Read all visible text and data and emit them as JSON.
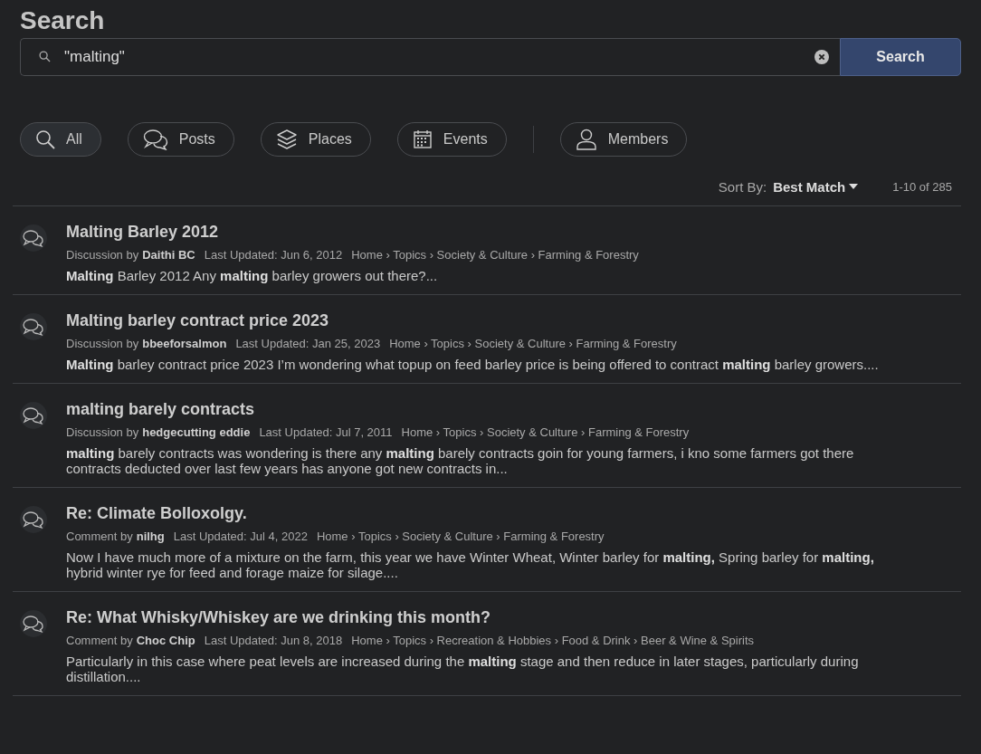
{
  "heading": "Search",
  "search": {
    "value": "\"malting\"",
    "button": "Search"
  },
  "filters": [
    {
      "label": "All",
      "kind": "all",
      "selected": true
    },
    {
      "label": "Posts",
      "kind": "posts",
      "selected": false
    },
    {
      "label": "Places",
      "kind": "places",
      "selected": false
    },
    {
      "label": "Events",
      "kind": "events",
      "selected": false
    },
    {
      "label": "Members",
      "kind": "members",
      "selected": false
    }
  ],
  "sort": {
    "label": "Sort By:",
    "value": "Best Match",
    "count": "1-10 of 285"
  },
  "results": [
    {
      "title": "Malting Barley 2012",
      "type": "Discussion by",
      "author": "Daithi BC",
      "updated": "Last Updated: Jun 6, 2012",
      "breadcrumb": "Home › Topics › Society & Culture › Farming & Forestry",
      "excerpt": "**Malting** Barley 2012 Any **malting** barley growers out there?..."
    },
    {
      "title": "Malting barley contract price 2023",
      "type": "Discussion by",
      "author": "bbeeforsalmon",
      "updated": "Last Updated: Jan 25, 2023",
      "breadcrumb": "Home › Topics › Society & Culture › Farming & Forestry",
      "excerpt": "**Malting** barley contract price 2023 I’m wondering what topup on feed barley price is being offered to contract **malting** barley growers...."
    },
    {
      "title": "malting barely contracts",
      "type": "Discussion by",
      "author": "hedgecutting eddie",
      "updated": "Last Updated: Jul 7, 2011",
      "breadcrumb": "Home › Topics › Society & Culture › Farming & Forestry",
      "excerpt": "**malting** barely contracts was wondering is there any **malting** barely contracts goin for young farmers, i kno some farmers got there contracts deducted over last few years has anyone got new contracts in..."
    },
    {
      "title": "Re: Climate Bolloxolgy.",
      "type": "Comment by",
      "author": "nilhg",
      "updated": "Last Updated: Jul 4, 2022",
      "breadcrumb": "Home › Topics › Society & Culture › Farming & Forestry",
      "excerpt": "Now I have much more of a mixture on the farm, this year we have Winter Wheat, Winter barley for **malting,** Spring barley for **malting,** hybrid winter rye for feed and forage maize for silage...."
    },
    {
      "title": "Re: What Whisky/Whiskey are we drinking this month?",
      "type": "Comment by",
      "author": "Choc Chip",
      "updated": "Last Updated: Jun 8, 2018",
      "breadcrumb": "Home › Topics › Recreation & Hobbies › Food & Drink › Beer & Wine & Spirits",
      "excerpt": "Particularly in this case where peat levels are increased during the **malting** stage and then reduce in later stages, particularly during distillation...."
    }
  ]
}
